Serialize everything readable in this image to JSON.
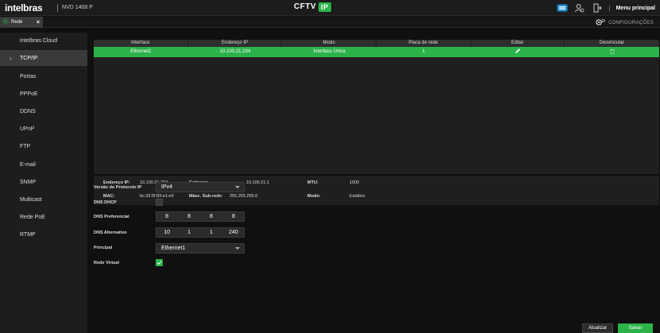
{
  "header": {
    "brand": "intelbras",
    "model": "NVD 1408 P",
    "center_title": "CFTV",
    "center_badge": "IP",
    "menu_principal": "Menu principal",
    "accent": "#2bb34a"
  },
  "tabbar": {
    "tab_label": "Rede",
    "tab_close": "×",
    "config_label": "CONFIGURAÇÕES"
  },
  "sidebar": {
    "items": [
      {
        "label": "Intelbras Cloud"
      },
      {
        "label": "TCP/IP",
        "active": true
      },
      {
        "label": "Portas"
      },
      {
        "label": "PPPoE"
      },
      {
        "label": "DDNS"
      },
      {
        "label": "UPnP"
      },
      {
        "label": "FTP"
      },
      {
        "label": "E-mail"
      },
      {
        "label": "SNMP"
      },
      {
        "label": "Multicast"
      },
      {
        "label": "Rede PoE"
      },
      {
        "label": "RTMP"
      }
    ]
  },
  "table": {
    "headers": [
      "Interface",
      "Endereço IP",
      "Modo",
      "Placa de rede",
      "Editar",
      "Desvincular"
    ],
    "rows": [
      {
        "interface": "Ethernet1",
        "ip": "10.100.21.234",
        "mode": "Interface Única",
        "nic": "1"
      }
    ]
  },
  "info": {
    "ip_label": "Endereço IP:",
    "ip_value": "10.100.21.234",
    "gateway_label": "Gateway:",
    "gateway_value": "10.100.21.1",
    "mtu_label": "MTU:",
    "mtu_value": "1500",
    "mac_label": "MAC:",
    "mac_value": "bc:32:5f:83:e1:e9",
    "mask_label": "Másc. Sub-rede:",
    "mask_value": "255.255.255.0",
    "mode_label": "Modo:",
    "mode_value": "Estático"
  },
  "form": {
    "ip_version_label": "Versão do Protocolo IP",
    "ip_version_value": "IPv4",
    "dhcp_label": "DNS DHCP",
    "dhcp_checked": false,
    "dns_pref_label": "DNS Preferencial",
    "dns_pref": [
      "8",
      "8",
      "8",
      "8"
    ],
    "dns_alt_label": "DNS Alternativo",
    "dns_alt": [
      "10",
      "1",
      "1",
      "240"
    ],
    "principal_label": "Principal",
    "principal_value": "Ethernet1",
    "virtual_label": "Rede Virtual",
    "virtual_checked": true
  },
  "buttons": {
    "refresh": "Atualizar",
    "save": "Salvar"
  }
}
